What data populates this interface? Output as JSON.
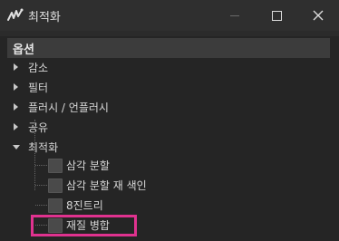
{
  "window": {
    "title": "최적화"
  },
  "panel": {
    "header": "옵션",
    "sections": [
      {
        "label": "감소",
        "expanded": false
      },
      {
        "label": "필터",
        "expanded": false
      },
      {
        "label": "플러시 / 언플러시",
        "expanded": false
      },
      {
        "label": "공유",
        "expanded": false
      },
      {
        "label": "최적화",
        "expanded": true
      }
    ],
    "options": [
      {
        "label": "삼각 분할",
        "checked": false
      },
      {
        "label": "삼각 분할 재 색인",
        "checked": false
      },
      {
        "label": "8진트리",
        "checked": false
      },
      {
        "label": "재질 병합",
        "checked": false,
        "highlighted": true
      }
    ]
  },
  "colors": {
    "highlight": "#e0328f",
    "background": "#252525",
    "header": "#3c3c3c"
  }
}
